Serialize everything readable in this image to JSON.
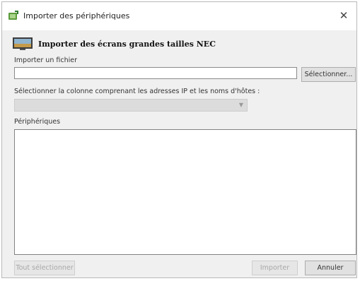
{
  "window": {
    "title": "Importer des périphériques",
    "close_icon": "close-icon",
    "close_glyph": "✕",
    "app_icon": "import-devices-icon"
  },
  "header": {
    "icon": "monitor-icon",
    "title": "Importer des écrans grandes tailles NEC"
  },
  "import_file": {
    "label": "Importer un fichier",
    "value": "",
    "placeholder": "",
    "browse_label": "Sélectionner..."
  },
  "column_select": {
    "label": "Sélectionner la colonne comprenant les adresses IP et les noms d'hôtes :",
    "selected": "",
    "enabled": false,
    "arrow_glyph": "▼"
  },
  "devices": {
    "label": "Périphériques",
    "items": []
  },
  "footer": {
    "select_all_label": "Tout sélectionner",
    "select_all_enabled": false,
    "import_label": "Importer",
    "import_enabled": false,
    "cancel_label": "Annuler"
  }
}
